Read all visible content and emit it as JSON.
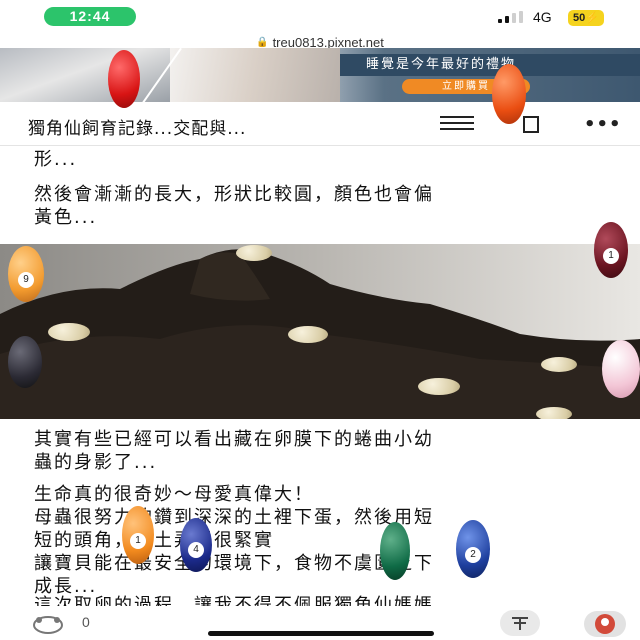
{
  "status_bar": {
    "time": "12:44",
    "network": "4G",
    "battery": "50"
  },
  "browser": {
    "url": "treu0813.pixnet.net"
  },
  "ad_banner": {
    "slogan": "睡覺是今年最好的禮物",
    "cta": "立即購買"
  },
  "header": {
    "title": "獨角仙飼育記錄...交配與...",
    "more": "•••"
  },
  "article": {
    "paragraphs": [
      "形...",
      "然後會漸漸的長大，形狀比較圓，顏色也會偏\n黃色...",
      "其實有些已經可以看出藏在卵膜下的蜷曲小幼\n蟲的身影了...",
      "生命真的很奇妙～母愛真偉大！\n母蟲很努力的鑽到深深的土裡下蛋，然後用短\n短的頭角，把土弄得很緊實\n讓寶貝能在最安全的環境下，食物不虞匱乏下\n成長...",
      "這次取卵的過程，讓我不得不佩服獨角仙媽媽"
    ]
  },
  "billiard_balls": [
    {
      "number": "9",
      "color": "#f29a2e"
    },
    {
      "number": "1",
      "color": "#6a1420"
    },
    {
      "number": "1",
      "color": "#f28a1e"
    },
    {
      "number": "4",
      "color": "#1b2a8a"
    },
    {
      "number": "2",
      "color": "#1e3f9e"
    }
  ],
  "bottom_bar": {
    "like_count": "0"
  },
  "colors": {
    "status_pill": "#2cc46b",
    "battery": "#f5d31e",
    "ad_slogan_bg": "#2f4a63",
    "ad_cta": "#f08a24"
  }
}
